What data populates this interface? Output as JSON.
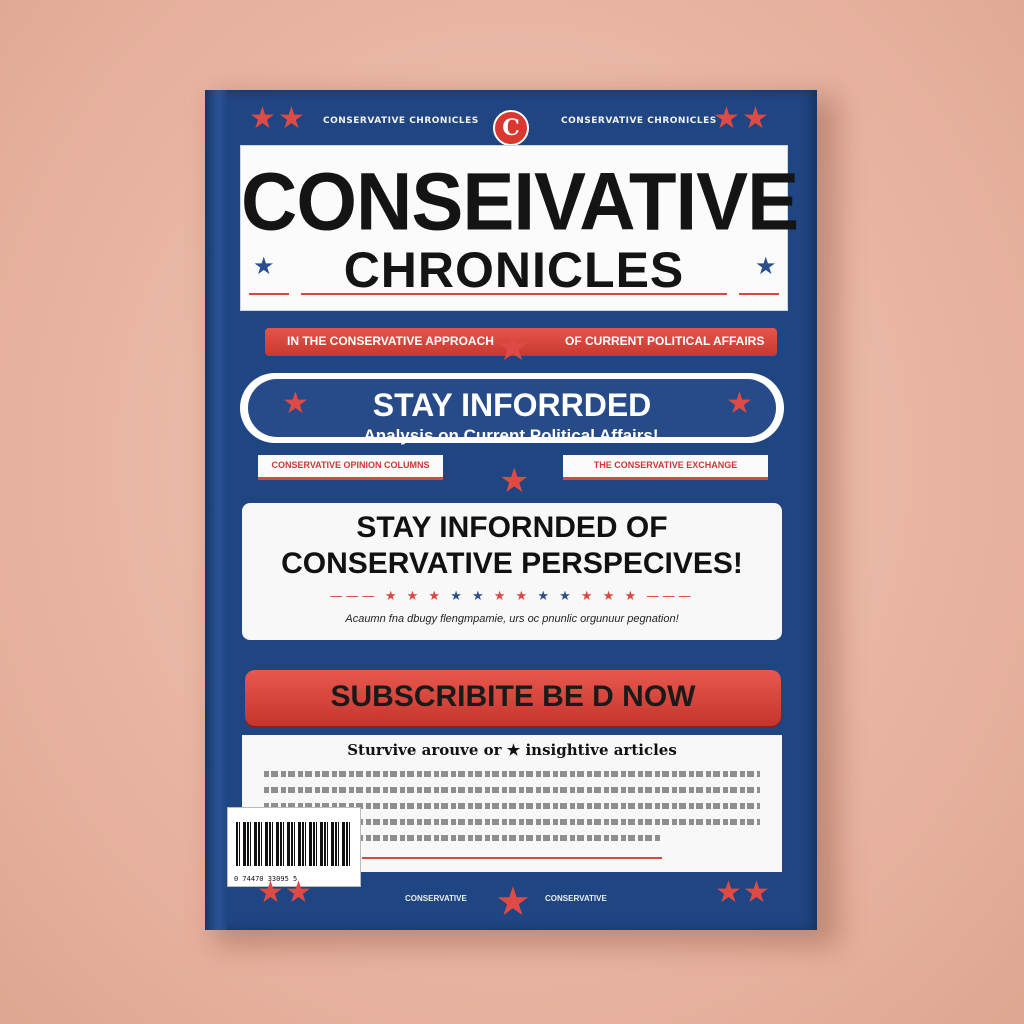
{
  "magazine": {
    "logo_letter": "C",
    "top_left_text": "CONSERVATIVE CHRONICLES",
    "top_right_text": "CONSERVATIVE CHRONICLES",
    "title_line1": "CONSEIVATIVE",
    "title_line2": "CHRONICLES",
    "ribbon_left": "IN THE CONSERVATIVE APPROACH",
    "ribbon_right": "OF CURRENT POLITICAL AFFAIRS",
    "banner_headline": "STAY INFORRDED",
    "banner_sub": "Analysis on Current Political Affairs!",
    "small_left": "CONSERVATIVE OPINION COLUMNS",
    "small_right": "THE CONSERVATIVE EXCHANGE",
    "panel_line1": "STAY INFORNDED OF",
    "panel_line2": "CONSERVATIVE PERSPECIVES!",
    "panel_sub": "Acaumn fna dbugy flengmpamie, urs oc pnunlic orgunuur pegnation!",
    "subscribe": "SUBSCRIBITE BE D NOW",
    "article_heading": "Sturvive arouve or ★ insightive articles",
    "barcode_number": "0 74470 33095 5",
    "bottom_left": "CONSERVATIVE",
    "bottom_right": "CONSERVATIVE"
  },
  "colors": {
    "cover_blue": "#1f4582",
    "accent_red": "#d9372f",
    "panel_white": "#f8f8f9",
    "background": "#e9b8a6"
  }
}
